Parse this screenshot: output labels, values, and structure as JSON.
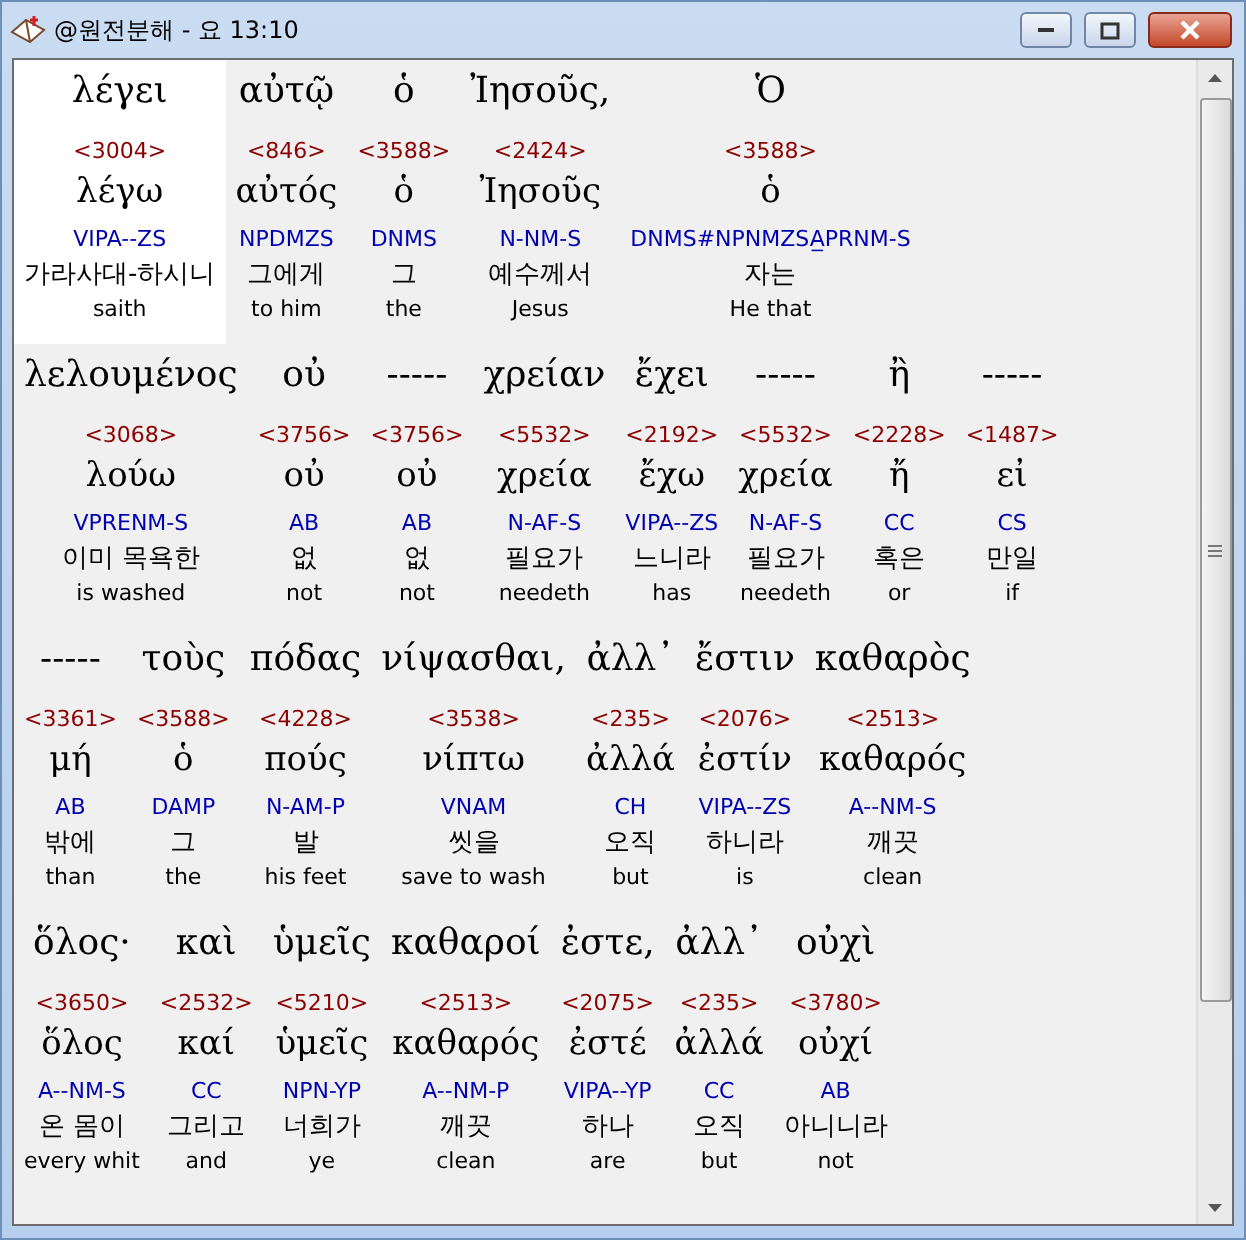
{
  "window": {
    "title": "@원전분해 - 요 13:10"
  },
  "lines": [
    {
      "words": [
        {
          "greek": "λέγει",
          "strongs": "<3004>",
          "lemma": "λέγω",
          "morph": "VIPA--ZS",
          "korean": "가라사대-하시니",
          "english": "saith",
          "selected": true
        },
        {
          "greek": "αὐτῷ",
          "strongs": "<846>",
          "lemma": "αὐτός",
          "morph": "NPDMZS",
          "korean": "그에게",
          "english": "to him",
          "selected": false
        },
        {
          "greek": "ὁ",
          "strongs": "<3588>",
          "lemma": "ὁ",
          "morph": "DNMS",
          "korean": "그",
          "english": "the",
          "selected": false
        },
        {
          "greek": "Ἰησοῦς,",
          "strongs": "<2424>",
          "lemma": "Ἰησοῦς",
          "morph": "N-NM-S",
          "korean": "예수께서",
          "english": "Jesus",
          "selected": false
        },
        {
          "greek": "Ὁ",
          "strongs": "<3588>",
          "lemma": "ὁ",
          "morph": "DNMS#NPNMZSA̲PRNM-S",
          "korean": "자는",
          "english": "He that",
          "selected": false
        }
      ]
    },
    {
      "words": [
        {
          "greek": "λελουμένος",
          "strongs": "<3068>",
          "lemma": "λούω",
          "morph": "VPRENM-S",
          "korean": "이미 목욕한",
          "english": "is washed",
          "selected": false
        },
        {
          "greek": "οὐ",
          "strongs": "<3756>",
          "lemma": "οὐ",
          "morph": "AB",
          "korean": "없",
          "english": "not",
          "selected": false
        },
        {
          "greek": "-----",
          "strongs": "<3756>",
          "lemma": "οὐ",
          "morph": "AB",
          "korean": "없",
          "english": "not",
          "selected": false
        },
        {
          "greek": "χρείαν",
          "strongs": "<5532>",
          "lemma": "χρεία",
          "morph": "N-AF-S",
          "korean": "필요가",
          "english": "needeth",
          "selected": false
        },
        {
          "greek": "ἔχει",
          "strongs": "<2192>",
          "lemma": "ἔχω",
          "morph": "VIPA--ZS",
          "korean": "느니라",
          "english": "has",
          "selected": false
        },
        {
          "greek": "-----",
          "strongs": "<5532>",
          "lemma": "χρεία",
          "morph": "N-AF-S",
          "korean": "필요가",
          "english": "needeth",
          "selected": false
        },
        {
          "greek": "ἢ",
          "strongs": "<2228>",
          "lemma": "ἤ",
          "morph": "CC",
          "korean": "혹은",
          "english": "or",
          "selected": false
        },
        {
          "greek": "-----",
          "strongs": "<1487>",
          "lemma": "εἰ",
          "morph": "CS",
          "korean": "만일",
          "english": "if",
          "selected": false
        }
      ]
    },
    {
      "words": [
        {
          "greek": "-----",
          "strongs": "<3361>",
          "lemma": "μή",
          "morph": "AB",
          "korean": "밖에",
          "english": "than",
          "selected": false
        },
        {
          "greek": "τοὺς",
          "strongs": "<3588>",
          "lemma": "ὁ",
          "morph": "DAMP",
          "korean": "그",
          "english": "the",
          "selected": false
        },
        {
          "greek": "πόδας",
          "strongs": "<4228>",
          "lemma": "πούς",
          "morph": "N-AM-P",
          "korean": "발",
          "english": "his feet",
          "selected": false
        },
        {
          "greek": "νίψασθαι,",
          "strongs": "<3538>",
          "lemma": "νίπτω",
          "morph": "VNAM",
          "korean": "씻을",
          "english": "save to wash",
          "selected": false
        },
        {
          "greek": "ἀλλ᾽",
          "strongs": "<235>",
          "lemma": "ἀλλά",
          "morph": "CH",
          "korean": "오직",
          "english": "but",
          "selected": false
        },
        {
          "greek": "ἔστιν",
          "strongs": "<2076>",
          "lemma": "ἐστίν",
          "morph": "VIPA--ZS",
          "korean": "하니라",
          "english": "is",
          "selected": false
        },
        {
          "greek": "καθαρὸς",
          "strongs": "<2513>",
          "lemma": "καθαρός",
          "morph": "A--NM-S",
          "korean": "깨끗",
          "english": "clean",
          "selected": false
        }
      ]
    },
    {
      "words": [
        {
          "greek": "ὅλος·",
          "strongs": "<3650>",
          "lemma": "ὅλος",
          "morph": "A--NM-S",
          "korean": "온 몸이",
          "english": "every whit",
          "selected": false
        },
        {
          "greek": "καὶ",
          "strongs": "<2532>",
          "lemma": "καί",
          "morph": "CC",
          "korean": "그리고",
          "english": "and",
          "selected": false
        },
        {
          "greek": "ὑμεῖς",
          "strongs": "<5210>",
          "lemma": "ὑμεῖς",
          "morph": "NPN-YP",
          "korean": "너희가",
          "english": "ye",
          "selected": false
        },
        {
          "greek": "καθαροί",
          "strongs": "<2513>",
          "lemma": "καθαρός",
          "morph": "A--NM-P",
          "korean": "깨끗",
          "english": "clean",
          "selected": false
        },
        {
          "greek": "ἐστε,",
          "strongs": "<2075>",
          "lemma": "ἐστέ",
          "morph": "VIPA--YP",
          "korean": "하나",
          "english": "are",
          "selected": false
        },
        {
          "greek": "ἀλλ᾽",
          "strongs": "<235>",
          "lemma": "ἀλλά",
          "morph": "CC",
          "korean": "오직",
          "english": "but",
          "selected": false
        },
        {
          "greek": "οὐχὶ",
          "strongs": "<3780>",
          "lemma": "οὐχί",
          "morph": "AB",
          "korean": "아니니라",
          "english": "not",
          "selected": false
        }
      ]
    }
  ]
}
